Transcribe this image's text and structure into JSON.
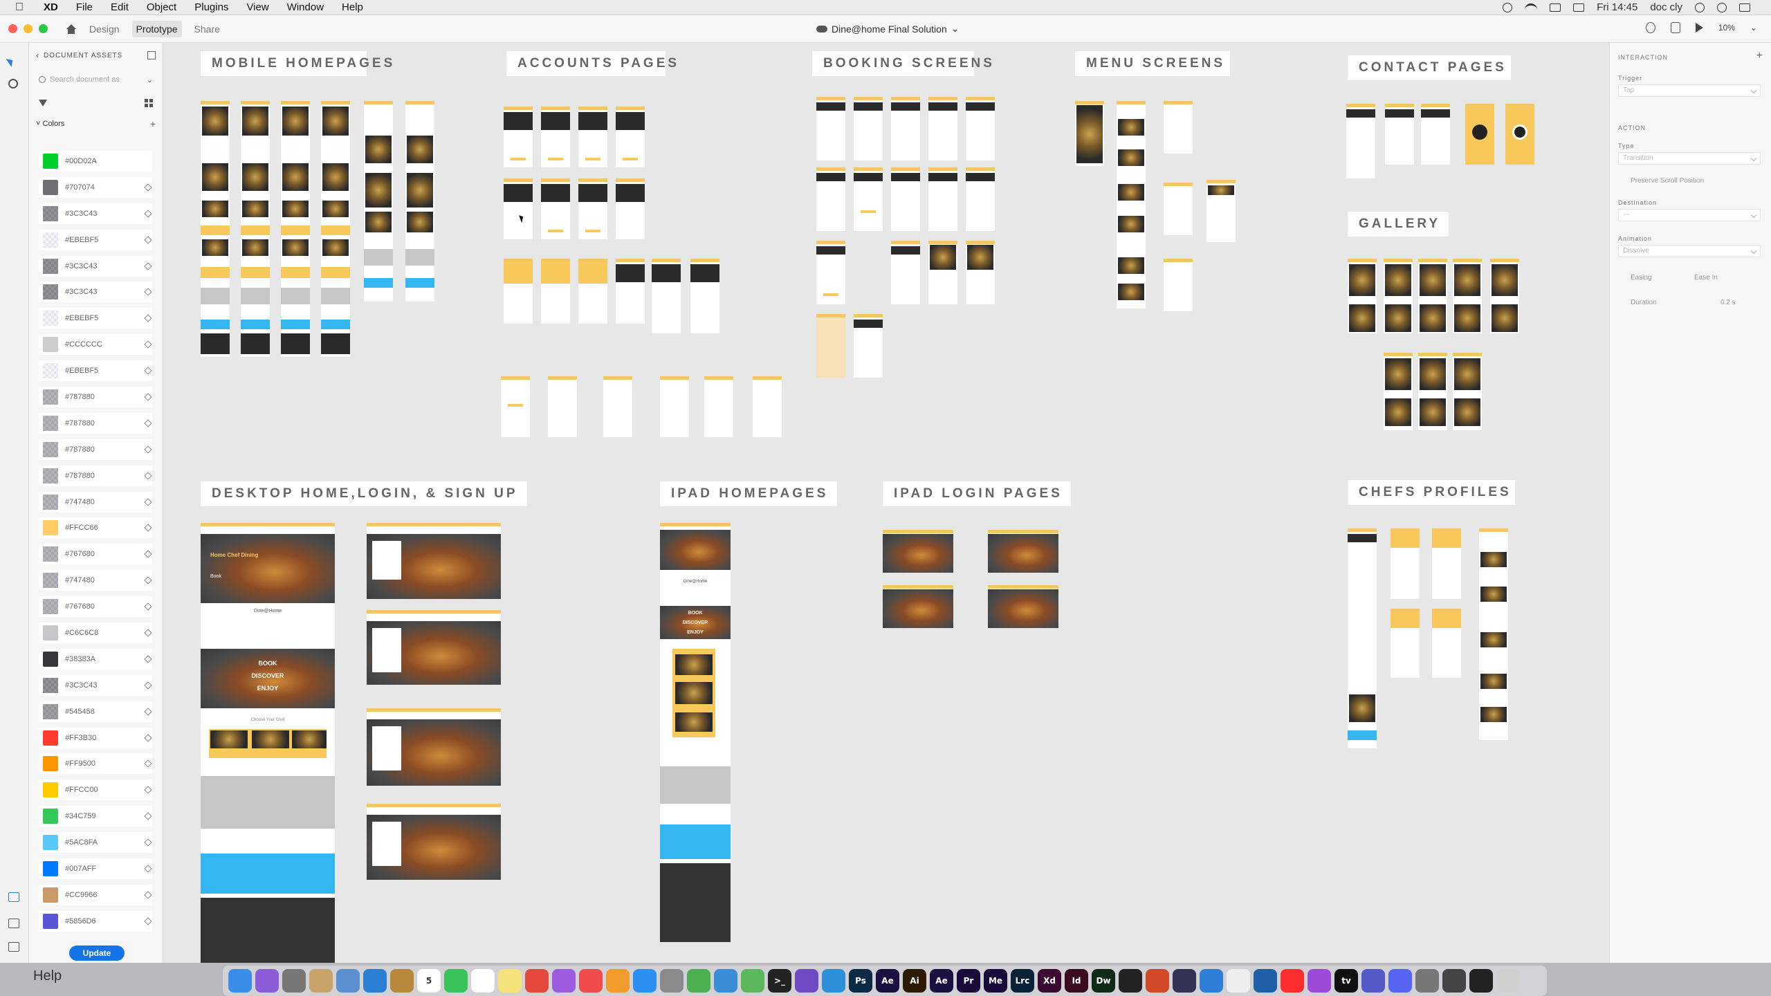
{
  "menubar": {
    "app": "XD",
    "items": [
      "File",
      "Edit",
      "Object",
      "Plugins",
      "View",
      "Window",
      "Help"
    ],
    "time": "Fri 14:45",
    "user": "doc cly"
  },
  "xdbar": {
    "tabs": [
      "Design",
      "Prototype",
      "Share"
    ],
    "active_tab": "Prototype",
    "doc_title": "Dine@home Final Solution",
    "zoom": "10%"
  },
  "assets": {
    "header": "DOCUMENT ASSETS",
    "search_placeholder": "Search document as",
    "colors_label": "Colors",
    "colors": [
      {
        "hex": "#00D02A",
        "fill": "#00D02A",
        "alpha": false
      },
      {
        "hex": "#707074",
        "fill": "#707074",
        "alpha": false
      },
      {
        "hex": "#3C3C43",
        "fill": "#3C3C43",
        "alpha": true
      },
      {
        "hex": "#EBEBF5",
        "fill": "#EBEBF5",
        "alpha": true
      },
      {
        "hex": "#3C3C43",
        "fill": "#3C3C43",
        "alpha": true
      },
      {
        "hex": "#3C3C43",
        "fill": "#3C3C43",
        "alpha": true
      },
      {
        "hex": "#EBEBF5",
        "fill": "#EBEBF5",
        "alpha": true
      },
      {
        "hex": "#CCCCCC",
        "fill": "#CCCCCC",
        "alpha": false
      },
      {
        "hex": "#EBEBF5",
        "fill": "#EBEBF5",
        "alpha": true
      },
      {
        "hex": "#787880",
        "fill": "#787880",
        "alpha": true
      },
      {
        "hex": "#787880",
        "fill": "#787880",
        "alpha": true
      },
      {
        "hex": "#787880",
        "fill": "#787880",
        "alpha": true
      },
      {
        "hex": "#787880",
        "fill": "#787880",
        "alpha": true
      },
      {
        "hex": "#747480",
        "fill": "#747480",
        "alpha": true
      },
      {
        "hex": "#FFCC66",
        "fill": "#FFCC66",
        "alpha": false
      },
      {
        "hex": "#767680",
        "fill": "#767680",
        "alpha": true
      },
      {
        "hex": "#747480",
        "fill": "#747480",
        "alpha": true
      },
      {
        "hex": "#767680",
        "fill": "#767680",
        "alpha": true
      },
      {
        "hex": "#C6C6C8",
        "fill": "#C6C6C8",
        "alpha": false
      },
      {
        "hex": "#38383A",
        "fill": "#38383A",
        "alpha": false
      },
      {
        "hex": "#3C3C43",
        "fill": "#3C3C43",
        "alpha": true
      },
      {
        "hex": "#545458",
        "fill": "#545458",
        "alpha": true
      },
      {
        "hex": "#FF3B30",
        "fill": "#FF3B30",
        "alpha": false
      },
      {
        "hex": "#FF9500",
        "fill": "#FF9500",
        "alpha": false
      },
      {
        "hex": "#FFCC00",
        "fill": "#FFCC00",
        "alpha": false
      },
      {
        "hex": "#34C759",
        "fill": "#34C759",
        "alpha": false
      },
      {
        "hex": "#5AC8FA",
        "fill": "#5AC8FA",
        "alpha": false
      },
      {
        "hex": "#007AFF",
        "fill": "#007AFF",
        "alpha": false
      },
      {
        "hex": "#CC9966",
        "fill": "#CC9966",
        "alpha": false
      },
      {
        "hex": "#5856D6",
        "fill": "#5856D6",
        "alpha": false
      }
    ],
    "update_label": "Update"
  },
  "canvas": {
    "sections": {
      "mobile": "MOBILE HOMEPAGES",
      "accounts": "ACCOUNTS PAGES",
      "booking": "BOOKING SCREENS",
      "menu": "MENU SCREENS",
      "contact": "CONTACT PAGES",
      "gallery": "GALLERY",
      "desktop": "DESKTOP HOME,LOGIN, & SIGN UP",
      "ipad_home": "IPAD HOMEPAGES",
      "ipad_login": "IPAD LOGIN PAGES",
      "chefs": "CHEFS PROFILES"
    },
    "desktop_texts": {
      "hero_title": "Home Chef Dining",
      "hero_book": "Book",
      "brand": "Dine@Home",
      "book": "BOOK",
      "discover": "DISCOVER",
      "enjoy": "ENJOY",
      "choose": "Choose Your Chef"
    },
    "ipad_texts": {
      "brand": "Dine@Home",
      "book": "BOOK",
      "discover": "DISCOVER",
      "enjoy": "ENJOY"
    }
  },
  "inspector": {
    "interaction_label": "INTERACTION",
    "trigger_label": "Trigger",
    "trigger_value": "Tap",
    "action_label": "ACTION",
    "type_label": "Type",
    "type_value": "Transition",
    "preserve_label": "Preserve Scroll Position",
    "destination_label": "Destination",
    "destination_value": "---",
    "animation_label": "Animation",
    "animation_value": "Dissolve",
    "easing_label": "Easing",
    "easing_value": "Ease In",
    "duration_label": "Duration",
    "duration_value": "0.2 s"
  },
  "dock": {
    "help": "Help",
    "apps": [
      {
        "name": "finder-icon",
        "label": "",
        "color": "#3b8ee8"
      },
      {
        "name": "siri-icon",
        "label": "",
        "color": "#8a5cd8"
      },
      {
        "name": "launchpad-icon",
        "label": "",
        "color": "#777"
      },
      {
        "name": "files-icon",
        "label": "",
        "color": "#c9a26a"
      },
      {
        "name": "preview-icon",
        "label": "",
        "color": "#5a8fd0"
      },
      {
        "name": "safari-icon",
        "label": "",
        "color": "#2a7fd4"
      },
      {
        "name": "notes-icon",
        "label": "",
        "color": "#b8893c"
      },
      {
        "name": "calendar-icon",
        "label": "5",
        "color": "#ffffff"
      },
      {
        "name": "facetime-icon",
        "label": "",
        "color": "#3ac35a"
      },
      {
        "name": "reminders-icon",
        "label": "",
        "color": "#ffffff"
      },
      {
        "name": "stickies-icon",
        "label": "",
        "color": "#f5e27a"
      },
      {
        "name": "chrome-icon",
        "label": "",
        "color": "#e5473b"
      },
      {
        "name": "music-icon",
        "label": "",
        "color": "#9d5ce0"
      },
      {
        "name": "news-icon",
        "label": "",
        "color": "#f14c4c"
      },
      {
        "name": "books-icon",
        "label": "",
        "color": "#f29b2d"
      },
      {
        "name": "appstore-icon",
        "label": "",
        "color": "#2c8ff2"
      },
      {
        "name": "settings-icon",
        "label": "",
        "color": "#8a8a8a"
      },
      {
        "name": "google-chrome-icon",
        "label": "",
        "color": "#4caf50"
      },
      {
        "name": "compass-icon",
        "label": "",
        "color": "#3c8dd8"
      },
      {
        "name": "maps-icon",
        "label": "",
        "color": "#5cb85c"
      },
      {
        "name": "terminal-icon",
        "label": ">_",
        "color": "#222222"
      },
      {
        "name": "visual-studio-icon",
        "label": "",
        "color": "#6e4bc4"
      },
      {
        "name": "vscode-icon",
        "label": "",
        "color": "#2d8fd8"
      },
      {
        "name": "photoshop-icon",
        "label": "Ps",
        "color": "#0b2a46"
      },
      {
        "name": "aftereffects-icon",
        "label": "Ae",
        "color": "#1b1042"
      },
      {
        "name": "illustrator-icon",
        "label": "Ai",
        "color": "#2d1a06"
      },
      {
        "name": "aftereffects2-icon",
        "label": "Ae",
        "color": "#1b1042"
      },
      {
        "name": "premiere-icon",
        "label": "Pr",
        "color": "#1a0a3a"
      },
      {
        "name": "mediaencoder-icon",
        "label": "Me",
        "color": "#1a0a3a"
      },
      {
        "name": "lightroom-icon",
        "label": "Lrc",
        "color": "#0a2238"
      },
      {
        "name": "xd-icon",
        "label": "Xd",
        "color": "#3a0a33"
      },
      {
        "name": "indesign-icon",
        "label": "Id",
        "color": "#3b0a1c"
      },
      {
        "name": "dreamweaver-icon",
        "label": "Dw",
        "color": "#0f2a16"
      },
      {
        "name": "acrobat-icon",
        "label": "",
        "color": "#222222"
      },
      {
        "name": "powerpoint-icon",
        "label": "",
        "color": "#d04a2a"
      },
      {
        "name": "davinci-icon",
        "label": "",
        "color": "#333355"
      },
      {
        "name": "xcode-icon",
        "label": "",
        "color": "#2f7ed8"
      },
      {
        "name": "textedit-icon",
        "label": "",
        "color": "#eeeeee"
      },
      {
        "name": "quicktime-icon",
        "label": "",
        "color": "#1f5fa8"
      },
      {
        "name": "youtube-icon",
        "label": "",
        "color": "#ff2d2d"
      },
      {
        "name": "podcasts-icon",
        "label": "",
        "color": "#9b4bd8"
      },
      {
        "name": "appletv-icon",
        "label": "tv",
        "color": "#111111"
      },
      {
        "name": "teams-icon",
        "label": "",
        "color": "#5559c8"
      },
      {
        "name": "discord-icon",
        "label": "",
        "color": "#5865f2"
      },
      {
        "name": "screens-icon",
        "label": "",
        "color": "#777"
      },
      {
        "name": "monitor-icon",
        "label": "",
        "color": "#444"
      },
      {
        "name": "activity-icon",
        "label": "",
        "color": "#222"
      },
      {
        "name": "trash-icon",
        "label": "",
        "color": "#cfcfcf"
      }
    ]
  }
}
